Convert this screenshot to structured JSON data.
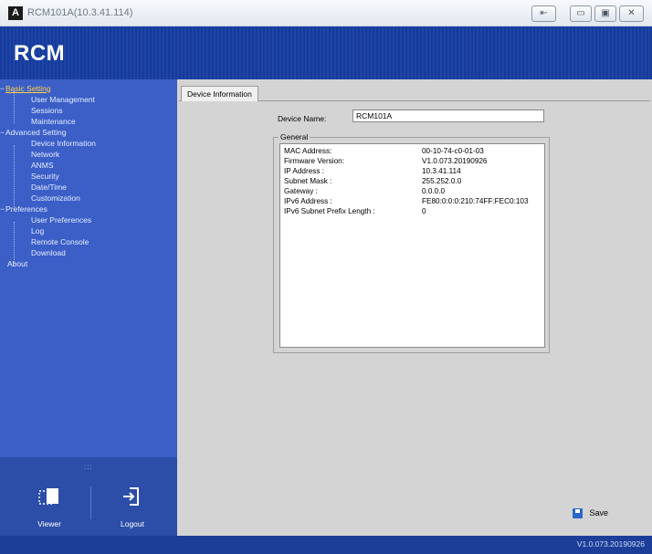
{
  "window": {
    "title": "RCM101A(10.3.41.114)",
    "controls": {
      "pin": "⇤",
      "minimize": "▭",
      "maximize": "▣",
      "close": "✕"
    }
  },
  "header": {
    "logo": "RCM"
  },
  "sidebar": {
    "groups": [
      {
        "label": "Basic Setting",
        "items": [
          "User Management",
          "Sessions",
          "Maintenance"
        ]
      },
      {
        "label": "Advanced Setting",
        "items": [
          "Device Information",
          "Network",
          "ANMS",
          "Security",
          "Date/Time",
          "Customization"
        ]
      },
      {
        "label": "Preferences",
        "items": [
          "User Preferences",
          "Log",
          "Remote Console",
          "Download"
        ]
      }
    ],
    "about": "About",
    "grip": ":::",
    "viewer_label": "Viewer",
    "logout_label": "Logout"
  },
  "main": {
    "tab_label": "Device Information",
    "device_name_label": "Device Name:",
    "device_name_value": "RCM101A",
    "group_title": "General",
    "info": [
      {
        "label": "MAC Address:",
        "value": "00-10-74-c0-01-03"
      },
      {
        "label": "Firmware Version:",
        "value": "V1.0.073.20190926"
      },
      {
        "label": "IP Address :",
        "value": "10.3.41.114"
      },
      {
        "label": "Subnet Mask :",
        "value": "255.252.0.0"
      },
      {
        "label": "Gateway :",
        "value": "0.0.0.0"
      },
      {
        "label": "IPv6 Address :",
        "value": "FE80:0:0:0:210:74FF:FEC0:103"
      },
      {
        "label": "IPv6 Subnet Prefix Length :",
        "value": "0"
      }
    ],
    "save_label": "Save"
  },
  "status": {
    "version": "V1.0.073.20190926"
  },
  "colors": {
    "header": "#1d45a8",
    "sidebar": "#3b5fc7",
    "selected": "#ffd24a",
    "status": "#1c3e99"
  }
}
